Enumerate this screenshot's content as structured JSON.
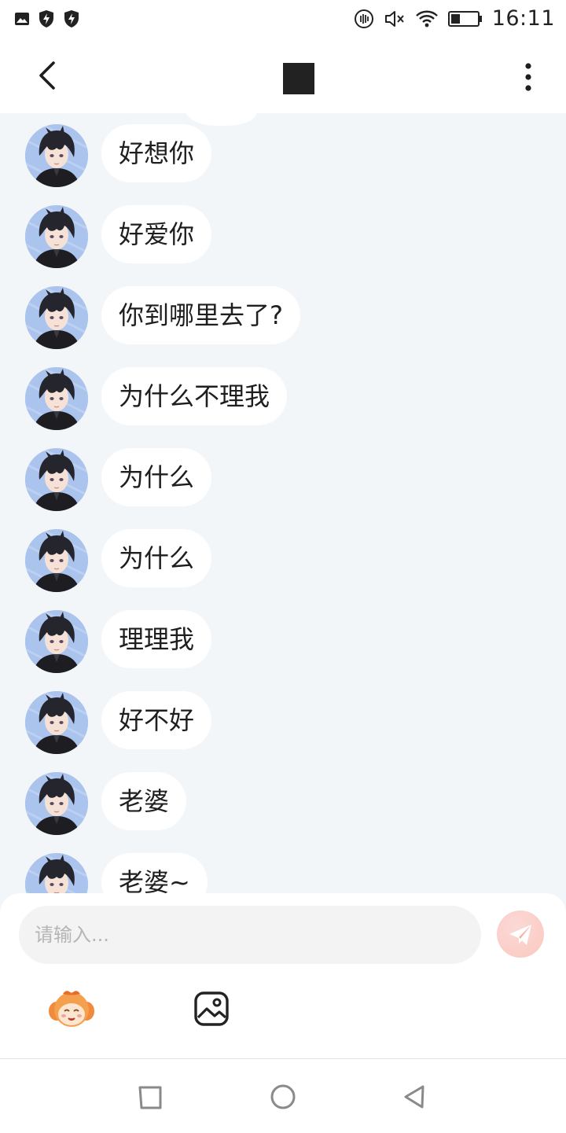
{
  "status_bar": {
    "time": "16:11",
    "left_icons": [
      "image-icon",
      "shield-icon",
      "shield-bolt-icon"
    ],
    "right_icons": [
      "vibrate-icon",
      "mute-icon",
      "wifi-icon",
      "battery-icon"
    ],
    "battery_level": 0.35
  },
  "header": {
    "back_icon": "chevron-left-icon",
    "more_icon": "more-vertical-icon"
  },
  "messages": [
    {
      "text": "好想你"
    },
    {
      "text": "好爱你"
    },
    {
      "text": "你到哪里去了?"
    },
    {
      "text": "为什么不理我"
    },
    {
      "text": "为什么"
    },
    {
      "text": "为什么"
    },
    {
      "text": "理理我"
    },
    {
      "text": "好不好"
    },
    {
      "text": "老婆"
    },
    {
      "text": "老婆~"
    }
  ],
  "input": {
    "placeholder": "请输入...",
    "value": ""
  },
  "toolbar": {
    "emoji_icon": "mascot-emoji-icon",
    "image_icon": "image-picker-icon",
    "send_icon": "paper-plane-icon"
  },
  "colors": {
    "chat_background": "#f3f6f9",
    "bubble": "#ffffff",
    "send_button": "#fbc8bf",
    "avatar_background": "#aac4ee"
  },
  "nav_bar": {
    "icons": [
      "square-recents-icon",
      "circle-home-icon",
      "triangle-back-icon"
    ]
  }
}
